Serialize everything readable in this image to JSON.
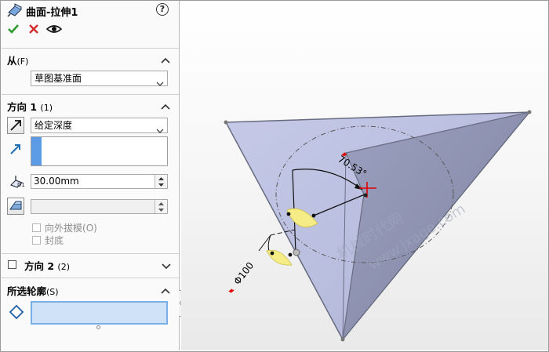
{
  "panel": {
    "title": "曲面-拉伸1",
    "help": "?",
    "from_section": {
      "label": "从",
      "shortcut": "(F)",
      "value": "草图基准面"
    },
    "direction1": {
      "label": "方向 1",
      "shortcut": "(1)",
      "end_condition": "给定深度",
      "depth": "30.00mm",
      "draft_outward": "向外拔模",
      "draft_outward_shortcut": "(O)",
      "cap_end": "封底"
    },
    "direction2": {
      "label": "方向 2",
      "shortcut": "(2)",
      "checked": false
    },
    "contours": {
      "label": "所选轮廓",
      "shortcut": "(S)"
    }
  },
  "viewport": {
    "dim_angle": "70.53°",
    "dim_diameter": "Φ100",
    "watermark_cn": "机械时代网",
    "watermark_url": "www.jxage.com"
  },
  "colors": {
    "accent": "#4a8fdc",
    "selection_fill": "#cfe2f7",
    "face_light": "#b8bde0",
    "face_dark": "#8a8fb0",
    "dim_red": "#e00000"
  }
}
